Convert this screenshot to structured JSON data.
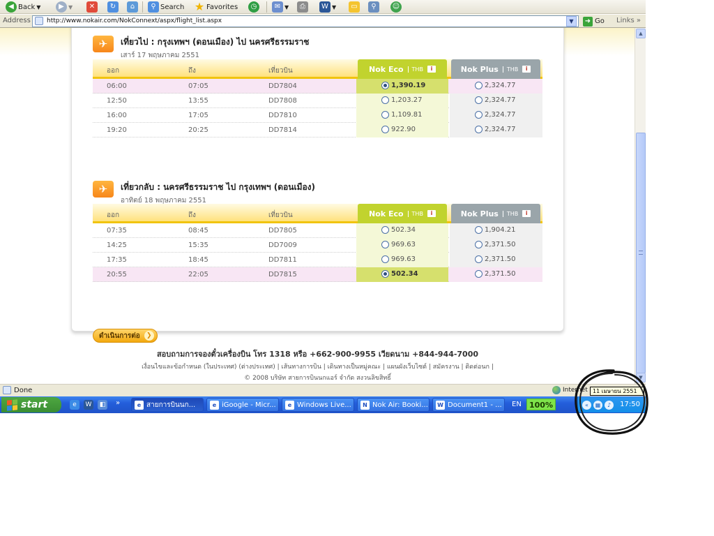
{
  "browser": {
    "toolbar": {
      "back_label": "Back",
      "search_label": "Search",
      "favorites_label": "Favorites"
    },
    "address": {
      "label": "Address",
      "url": "http://www.nokair.com/NokConnext/aspx/flight_list.aspx",
      "go_label": "Go",
      "links_label": "Links",
      "links_chevron": "»"
    },
    "status": {
      "text": "Done",
      "zone": "Internet",
      "tooltip_date": "11 เมษายน 2551"
    }
  },
  "page": {
    "outbound": {
      "title": "เที่ยวไป : กรุงเทพฯ (ดอนเมือง) ไป นครศรีธรรมราช",
      "date": "เสาร์ 17 พฤษภาคม 2551",
      "columns": {
        "depart": "ออก",
        "arrive": "ถึง",
        "flight": "เที่ยวบิน"
      },
      "eco_label": "Nok Eco",
      "plus_label": "Nok Plus",
      "currency": "THB",
      "rows": [
        {
          "depart": "06:00",
          "arrive": "07:05",
          "flight": "DD7804",
          "eco": "1,390.19",
          "plus": "2,324.77",
          "selected": true
        },
        {
          "depart": "12:50",
          "arrive": "13:55",
          "flight": "DD7808",
          "eco": "1,203.27",
          "plus": "2,324.77",
          "selected": false
        },
        {
          "depart": "16:00",
          "arrive": "17:05",
          "flight": "DD7810",
          "eco": "1,109.81",
          "plus": "2,324.77",
          "selected": false
        },
        {
          "depart": "19:20",
          "arrive": "20:25",
          "flight": "DD7814",
          "eco": "922.90",
          "plus": "2,324.77",
          "selected": false
        }
      ]
    },
    "return": {
      "title": "เที่ยวกลับ : นครศรีธรรมราช ไป กรุงเทพฯ (ดอนเมือง)",
      "date": "อาทิตย์ 18 พฤษภาคม 2551",
      "columns": {
        "depart": "ออก",
        "arrive": "ถึง",
        "flight": "เที่ยวบิน"
      },
      "eco_label": "Nok Eco",
      "plus_label": "Nok Plus",
      "currency": "THB",
      "rows": [
        {
          "depart": "07:35",
          "arrive": "08:45",
          "flight": "DD7805",
          "eco": "502.34",
          "plus": "1,904.21",
          "selected": false
        },
        {
          "depart": "14:25",
          "arrive": "15:35",
          "flight": "DD7009",
          "eco": "969.63",
          "plus": "2,371.50",
          "selected": false
        },
        {
          "depart": "17:35",
          "arrive": "18:45",
          "flight": "DD7811",
          "eco": "969.63",
          "plus": "2,371.50",
          "selected": false
        },
        {
          "depart": "20:55",
          "arrive": "22:05",
          "flight": "DD7815",
          "eco": "502.34",
          "plus": "2,371.50",
          "selected": true
        }
      ]
    },
    "continue_label": "ดำเนินการต่อ",
    "footer": {
      "line1": "สอบถามการจองตั๋วเครื่องบิน โทร 1318 หรือ +662-900-9955 เวียดนาม +844-944-7000",
      "line2": "เงื่อนไขและข้อกำหนด (ในประเทศ) (ต่างประเทศ) | เส้นทางการบิน | เดินทางเป็นหมู่คณะ | แผนผังเว็บไซต์ | สมัครงาน | ติดต่อนก |",
      "line3": "© 2008 บริษัท สายการบินนกแอร์ จำกัด สงวนลิขสิทธิ์"
    }
  },
  "taskbar": {
    "start_label": "start",
    "tasks": [
      {
        "label": "สายการบินนก...",
        "icon": "ie-icon",
        "active": true
      },
      {
        "label": "iGoogle - Micr...",
        "icon": "ie-icon",
        "active": false
      },
      {
        "label": "Windows Live...",
        "icon": "ie-icon",
        "active": false
      },
      {
        "label": "Nok Air: Booki...",
        "icon": "nokair-icon",
        "active": false
      },
      {
        "label": "Document1 - ...",
        "icon": "word-icon",
        "active": false
      }
    ],
    "language": "EN",
    "zoom": "100%",
    "clock": "17:50"
  },
  "colors": {
    "eco_green": "#c1d32e",
    "plus_grey": "#9aa5aa",
    "selected_row": "#f8e6f4",
    "header_yellow": "#ffe27d",
    "nok_orange": "#f7861a"
  }
}
